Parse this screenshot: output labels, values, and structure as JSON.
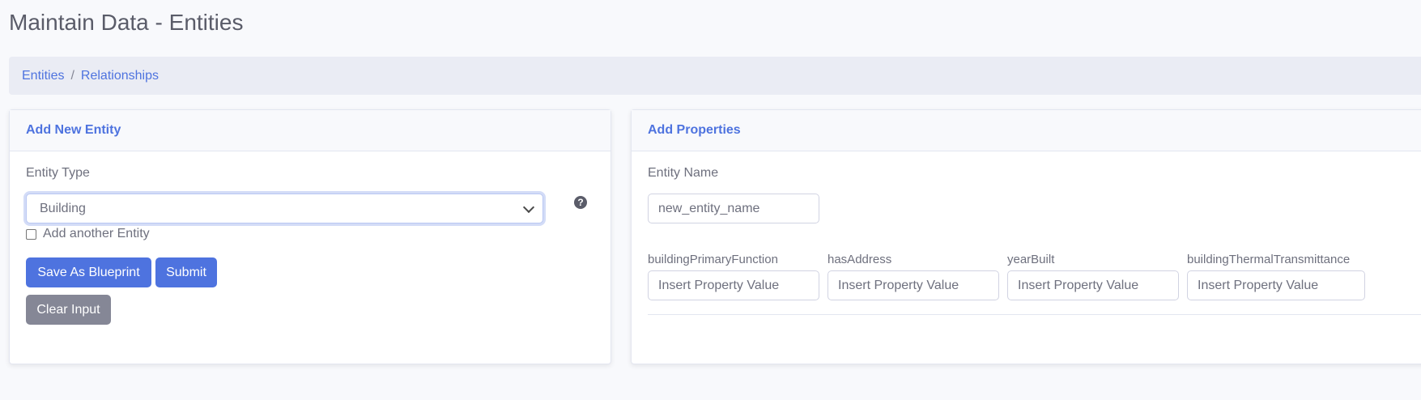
{
  "page": {
    "title": "Maintain Data - Entities"
  },
  "breadcrumb": {
    "items": [
      "Entities",
      "Relationships"
    ],
    "separator": "/"
  },
  "add_entity": {
    "header": "Add New Entity",
    "entity_type_label": "Entity Type",
    "entity_type_value": "Building",
    "help_icon": "question-circle-icon",
    "add_another_label": "Add another Entity",
    "add_another_checked": false,
    "save_blueprint_label": "Save As Blueprint",
    "submit_label": "Submit",
    "clear_label": "Clear Input"
  },
  "add_properties": {
    "header": "Add Properties",
    "entity_name_label": "Entity Name",
    "entity_name_placeholder": "new_entity_name",
    "properties": [
      {
        "label": "buildingPrimaryFunction",
        "placeholder": "Insert Property Value"
      },
      {
        "label": "hasAddress",
        "placeholder": "Insert Property Value"
      },
      {
        "label": "yearBuilt",
        "placeholder": "Insert Property Value"
      },
      {
        "label": "buildingThermalTransmittance",
        "placeholder": "Insert Property Value"
      }
    ]
  },
  "colors": {
    "primary": "#4e73df",
    "secondary": "#858796",
    "background": "#f8f9fc",
    "breadcrumb_bg": "#eaecf4",
    "text": "#5a5c69"
  }
}
